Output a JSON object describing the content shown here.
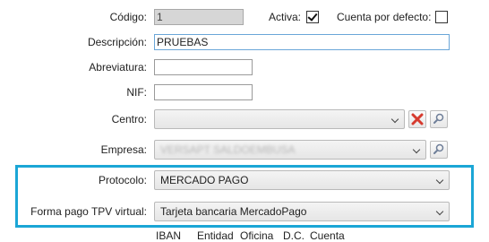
{
  "form": {
    "codigo": {
      "label": "Código:",
      "value": "1"
    },
    "activa": {
      "label": "Activa:",
      "checked": true
    },
    "cuenta_defecto": {
      "label": "Cuenta por defecto:",
      "checked": false
    },
    "descripcion": {
      "label": "Descripción:",
      "value": "PRUEBAS"
    },
    "abreviatura": {
      "label": "Abreviatura:",
      "value": ""
    },
    "nif": {
      "label": "NIF:",
      "value": ""
    },
    "centro": {
      "label": "Centro:",
      "value": ""
    },
    "empresa": {
      "label": "Empresa:",
      "value": "VERSAPT SALDOEMBUSA"
    },
    "protocolo": {
      "label": "Protocolo:",
      "value": "MERCADO PAGO"
    },
    "forma_pago": {
      "label": "Forma pago TPV virtual:",
      "value": "Tarjeta bancaria MercadoPago"
    }
  },
  "bank_headers": {
    "iban": "IBAN",
    "entidad": "Entidad",
    "oficina": "Oficina",
    "dc": "D.C.",
    "cuenta": "Cuenta"
  },
  "icons": {
    "clear": "red-x-icon",
    "search": "search-icon"
  },
  "colors": {
    "highlight": "#1ba6d6",
    "clear_icon": "#d63b2f"
  }
}
